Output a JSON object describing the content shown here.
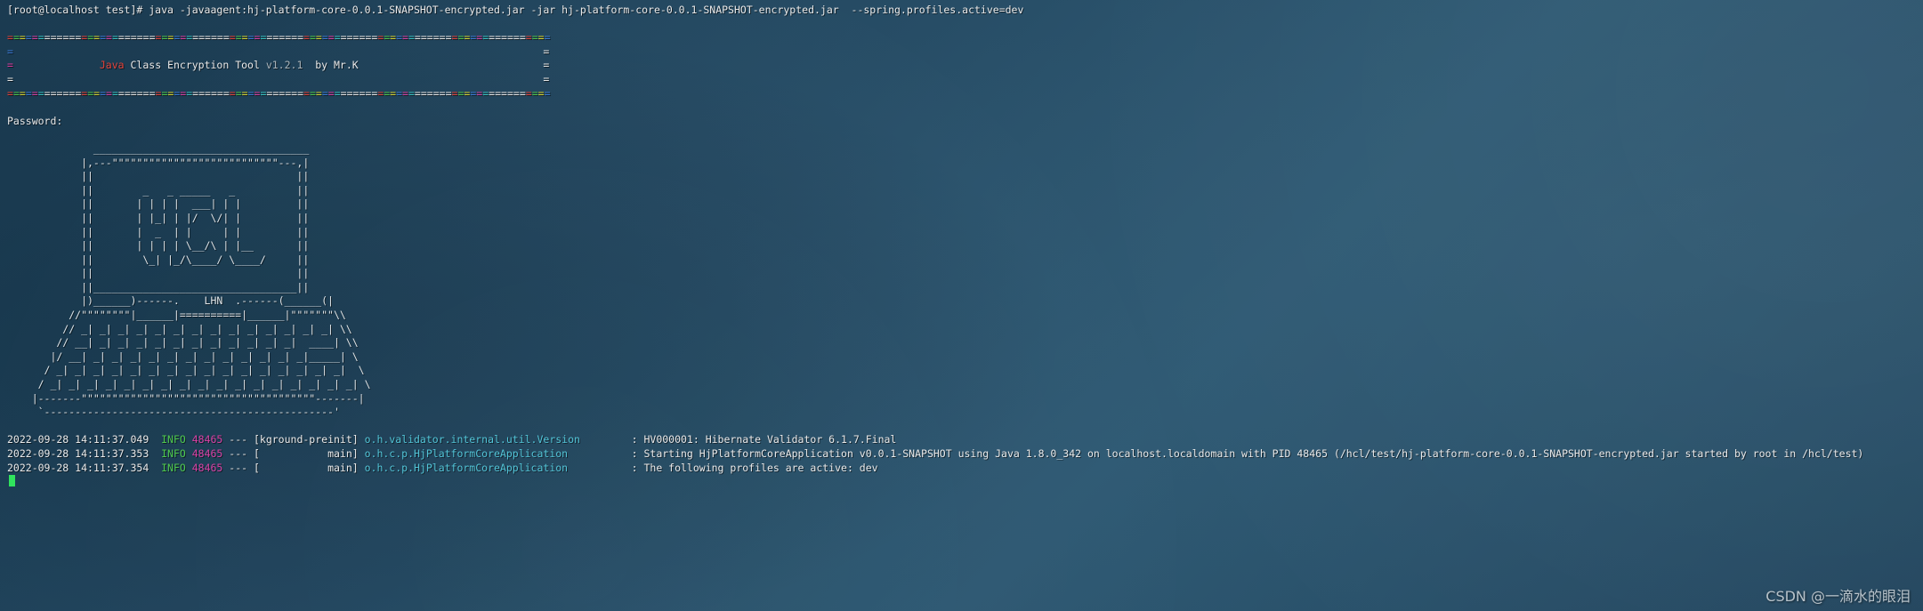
{
  "terminal": {
    "background_color": "#234861",
    "foreground_color": "#e9e9e9",
    "prompt": "[root@localhost test]# ",
    "command": "java -javaagent:hj-platform-core-0.0.1-SNAPSHOT-encrypted.jar -jar hj-platform-core-0.0.1-SNAPSHOT-encrypted.jar  --spring.profiles.active=dev",
    "full_command_line": "[root@localhost test]# java -javaagent:hj-platform-core-0.0.1-SNAPSHOT-encrypted.jar -jar hj-platform-core-0.0.1-SNAPSHOT-encrypted.jar  --spring.profiles.active=dev"
  },
  "banner": {
    "border_top": "========================================================================================",
    "border_bottom": "========================================================================================",
    "edge_left": "=",
    "edge_right": "=",
    "title_java": "Java",
    "title_main": " Class Encryption Tool ",
    "title_version": "v1.2.1",
    "title_author": "  by Mr.K",
    "colors": {
      "red": "#e2433b",
      "green": "#4ec94e",
      "yellow": "#d8d531",
      "blue": "#3b7cd8",
      "magenta": "#d93fa3",
      "cyan": "#39c6c6",
      "white": "#e9e9e9",
      "grey": "#a9b4bb"
    }
  },
  "password_prompt": "Password:",
  "ascii_art": {
    "label": "LHN",
    "lines": [
      "              ___________________________________",
      "            |,---\"\"\"\"\"\"\"\"\"\"\"\"\"\"\"\"\"\"\"\"\"\"\"\"\"\"\"---,|",
      "            ||                                 ||",
      "            ||        _   _ _____   _          ||",
      "            ||       | | | |  ___| | |         ||",
      "            ||       | |_| | |/  \\/| |         ||",
      "            ||       |  _  | |     | |         ||",
      "            ||       | | | | \\__/\\ | |__       ||",
      "            ||        \\_| |_/\\____/ \\____/     ||",
      "            ||                                 ||",
      "            ||_________________________________||",
      "            |)______)------.    LHN  .------(______(|",
      "          //\"\"\"\"\"\"\"\"|______|==========|______|\"\"\"\"\"\"\"\\\\",
      "         // _| _| _| _| _| _| _| _| _| _| _| _| _| _| \\\\",
      "        // __| _| _| _| _| _| _| _| _| _| _| _|  ____| \\\\",
      "       |/ __| _| _| _| _| _| _| _| _| _| _| _| _|_____| \\",
      "      / _| _| _| _| _| _| _| _| _| _| _| _| _| _| _| _|  \\",
      "     / _| _| _| _| _| _| _| _| _| _| _| _| _| _| _| _| _| \\",
      "    |-------\"\"\"\"\"\"\"\"\"\"\"\"\"\"\"\"\"\"\"\"\"\"\"\"\"\"\"\"\"\"\"\"\"\"\"\"\"\"-------|",
      "     `-----------------------------------------------'"
    ]
  },
  "logs": [
    {
      "timestamp": "2022-09-28 14:11:37.049",
      "level": "INFO",
      "pid": "48465",
      "dashes": "---",
      "thread": "[kground-preinit]",
      "logger": "o.h.validator.internal.util.Version",
      "separator": ": ",
      "message": "HV000001: Hibernate Validator 6.1.7.Final"
    },
    {
      "timestamp": "2022-09-28 14:11:37.353",
      "level": "INFO",
      "pid": "48465",
      "dashes": "---",
      "thread": "[           main]",
      "logger": "o.h.c.p.HjPlatformCoreApplication",
      "separator": ": ",
      "message": "Starting HjPlatformCoreApplication v0.0.1-SNAPSHOT using Java 1.8.0_342 on localhost.localdomain with PID 48465 (/hcl/test/hj-platform-core-0.0.1-SNAPSHOT-encrypted.jar started by root in /hcl/test)"
    },
    {
      "timestamp": "2022-09-28 14:11:37.354",
      "level": "INFO",
      "pid": "48465",
      "dashes": "---",
      "thread": "[           main]",
      "logger": "o.h.c.p.HjPlatformCoreApplication",
      "separator": ": ",
      "message": "The following profiles are active: dev"
    }
  ],
  "watermark": "CSDN @一滴水的眼泪"
}
